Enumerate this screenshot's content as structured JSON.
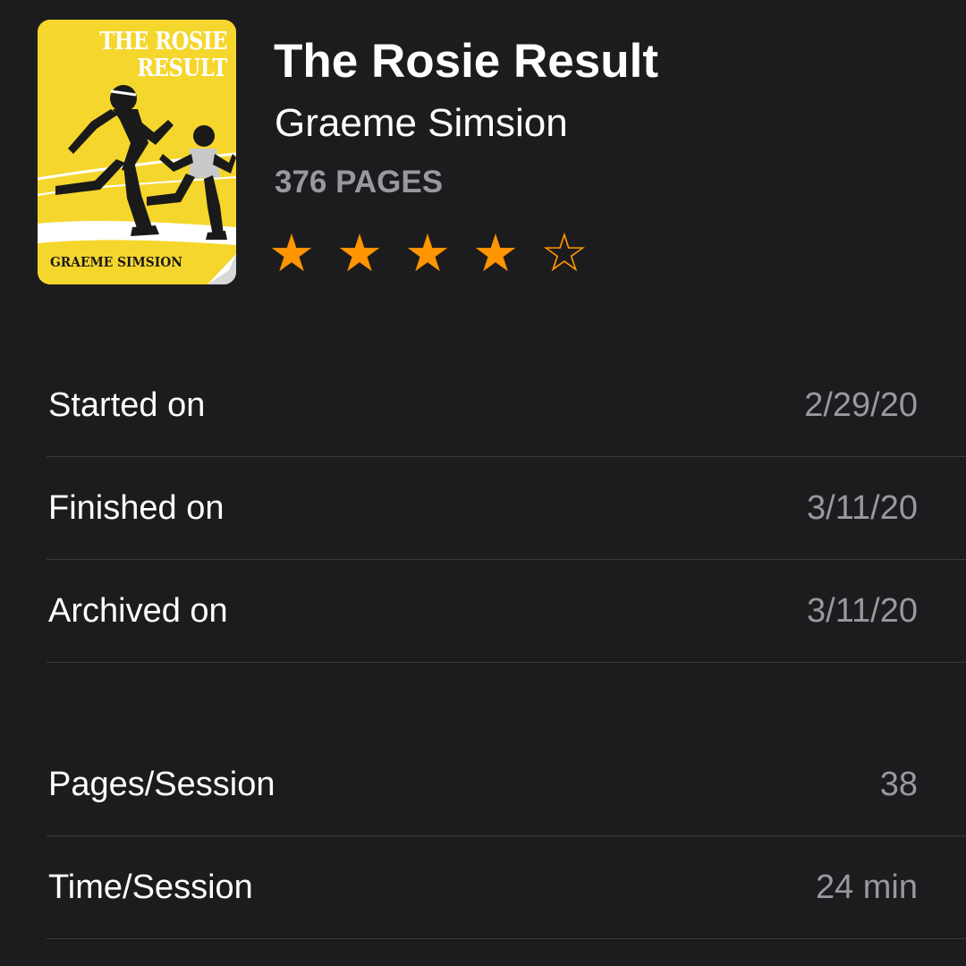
{
  "book": {
    "title": "The Rosie Result",
    "author": "Graeme Simsion",
    "pages": "376 PAGES",
    "rating": 4,
    "rating_max": 5,
    "cover": {
      "title_line1": "THE ROSIE",
      "title_line2": "RESULT",
      "author": "GRAEME SIMSION",
      "background_color": "#f5d62c"
    }
  },
  "dates": [
    {
      "label": "Started on",
      "value": "2/29/20"
    },
    {
      "label": "Finished on",
      "value": "3/11/20"
    },
    {
      "label": "Archived on",
      "value": "3/11/20"
    }
  ],
  "stats": [
    {
      "label": "Pages/Session",
      "value": "38"
    },
    {
      "label": "Time/Session",
      "value": "24 min"
    }
  ],
  "icons": {
    "filled_star": "star-filled-icon",
    "empty_star": "star-empty-icon"
  },
  "colors": {
    "background": "#1c1c1e",
    "accent": "#ff9500",
    "secondary_text": "#98989d",
    "separator": "#3a3a3c"
  }
}
